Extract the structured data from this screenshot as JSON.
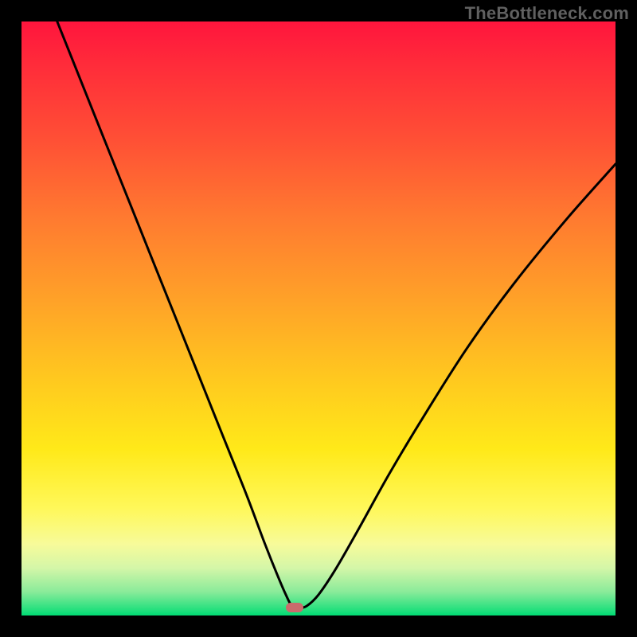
{
  "watermark": "TheBottleneck.com",
  "chart_data": {
    "type": "line",
    "title": "",
    "xlabel": "",
    "ylabel": "",
    "xlim": [
      0,
      100
    ],
    "ylim": [
      0,
      100
    ],
    "grid": false,
    "legend": false,
    "series": [
      {
        "name": "curve",
        "x": [
          6,
          10,
          14,
          18,
          22,
          26,
          30,
          34,
          38,
          41,
          43,
          44.5,
          45.5,
          46.5,
          48,
          50,
          53,
          57,
          62,
          68,
          75,
          83,
          92,
          100
        ],
        "y": [
          100,
          90,
          80,
          70,
          60,
          50,
          40,
          30,
          20,
          12,
          7,
          3.5,
          1.6,
          1.2,
          1.6,
          3.5,
          8,
          15,
          24,
          34,
          45,
          56,
          67,
          76
        ],
        "color": "#000000"
      }
    ],
    "marker": {
      "x": 46,
      "y": 1.3,
      "color": "#cb6b6c"
    },
    "background_gradient": {
      "stops": [
        "#ff153d",
        "#ff7a30",
        "#ffe919",
        "#f7fb9a",
        "#00db73"
      ]
    }
  }
}
